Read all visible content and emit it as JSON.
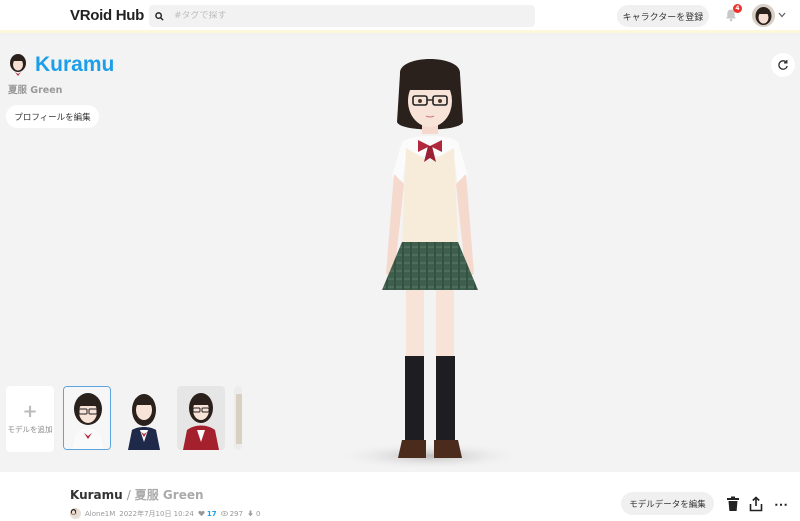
{
  "header": {
    "logo": "VRoid Hub",
    "search_placeholder": "#タグで探す",
    "register_label": "キャラクターを登録",
    "notification_count": "4"
  },
  "character": {
    "name": "Kuramu",
    "model_name": "夏服 Green",
    "edit_profile_label": "プロフィールを編集"
  },
  "models": {
    "add_label": "モデルを追加",
    "add_symbol": "+"
  },
  "bottom": {
    "title": "Kuramu",
    "separator": "/",
    "variant": "夏服 Green",
    "author": "Alone1M",
    "date": "2022年7月10日 10:24",
    "likes": "17",
    "views": "297",
    "downloads": "0",
    "edit_data_label": "モデルデータを編集",
    "more_symbol": "⋯"
  },
  "colors": {
    "accent": "#1c9fe8",
    "badge": "#f0322d"
  }
}
